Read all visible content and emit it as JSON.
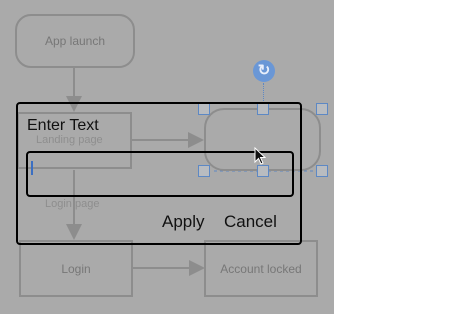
{
  "diagram": {
    "nodes": {
      "app_launch": "App launch",
      "landing_page": "",
      "empty_node": "",
      "login": "Login",
      "account_locked": "Account locked"
    },
    "edge_labels": {
      "landing_page": "Landing page",
      "login_page": "Login page"
    }
  },
  "dialog": {
    "title": "Enter Text",
    "input_value": "",
    "apply_label": "Apply",
    "cancel_label": "Cancel"
  },
  "icons": {
    "rotate": "rotate-icon",
    "cursor": "mouse-pointer-icon"
  },
  "colors": {
    "canvas_overlay": "#aaaaaa",
    "node_border": "#8d8d8d",
    "selection_handle": "#5d88c4",
    "rotate_handle": "#6a97d6"
  }
}
